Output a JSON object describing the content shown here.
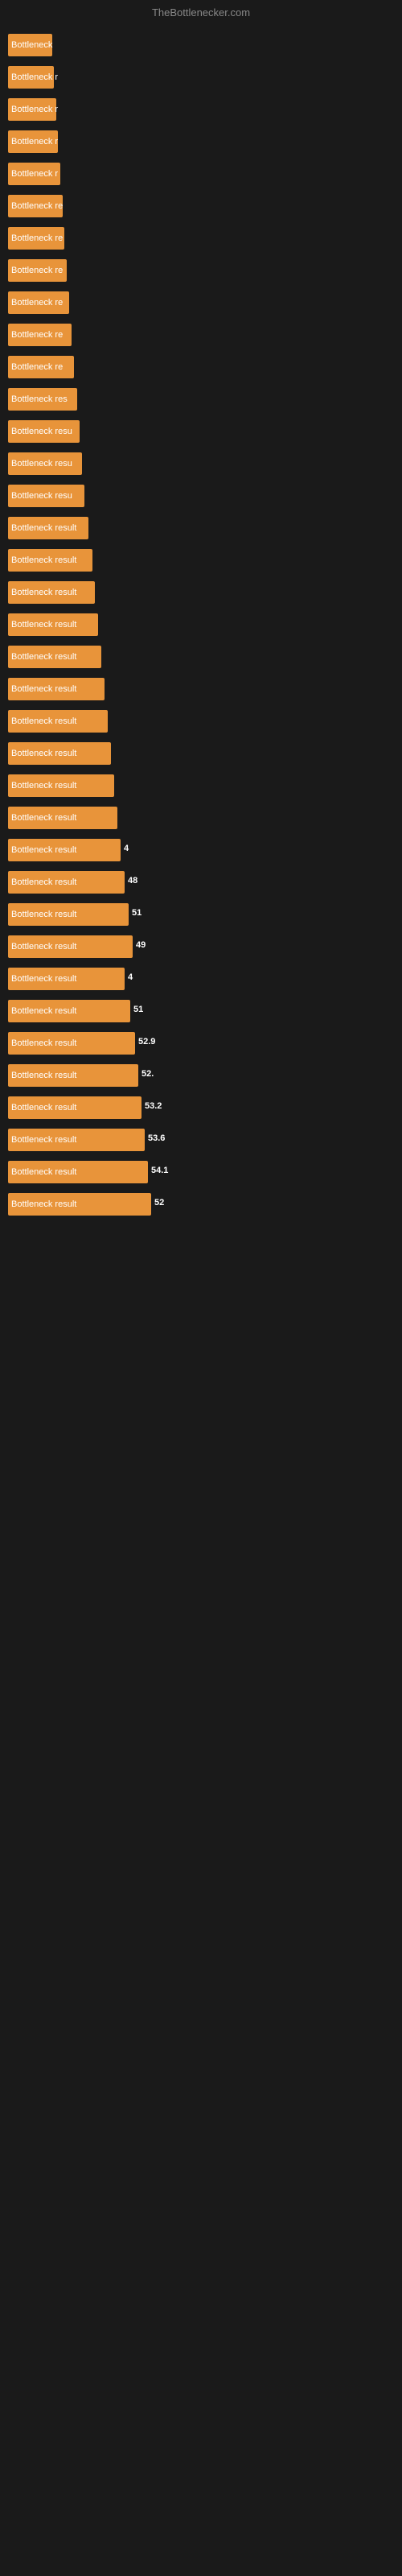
{
  "header": {
    "title": "TheBottlenecker.com"
  },
  "bars": [
    {
      "label": "Bottleneck",
      "width": 55,
      "value": "",
      "value_pos": "inside"
    },
    {
      "label": "Bottleneck r",
      "width": 57,
      "value": "",
      "value_pos": "inside"
    },
    {
      "label": "Bottleneck r",
      "width": 60,
      "value": "",
      "value_pos": "inside"
    },
    {
      "label": "Bottleneck r",
      "width": 62,
      "value": "",
      "value_pos": "inside"
    },
    {
      "label": "Bottleneck r",
      "width": 65,
      "value": "",
      "value_pos": "inside"
    },
    {
      "label": "Bottleneck re",
      "width": 68,
      "value": "",
      "value_pos": "inside"
    },
    {
      "label": "Bottleneck re",
      "width": 70,
      "value": "",
      "value_pos": "inside"
    },
    {
      "label": "Bottleneck re",
      "width": 73,
      "value": "",
      "value_pos": "inside"
    },
    {
      "label": "Bottleneck re",
      "width": 76,
      "value": "",
      "value_pos": "inside"
    },
    {
      "label": "Bottleneck re",
      "width": 79,
      "value": "",
      "value_pos": "inside"
    },
    {
      "label": "Bottleneck re",
      "width": 82,
      "value": "",
      "value_pos": "inside"
    },
    {
      "label": "Bottleneck res",
      "width": 86,
      "value": "",
      "value_pos": "inside"
    },
    {
      "label": "Bottleneck resu",
      "width": 89,
      "value": "",
      "value_pos": "inside"
    },
    {
      "label": "Bottleneck resu",
      "width": 92,
      "value": "",
      "value_pos": "inside"
    },
    {
      "label": "Bottleneck resu",
      "width": 95,
      "value": "",
      "value_pos": "inside"
    },
    {
      "label": "Bottleneck result",
      "width": 100,
      "value": "",
      "value_pos": "inside"
    },
    {
      "label": "Bottleneck result",
      "width": 105,
      "value": "",
      "value_pos": "inside"
    },
    {
      "label": "Bottleneck result",
      "width": 108,
      "value": "",
      "value_pos": "inside"
    },
    {
      "label": "Bottleneck result",
      "width": 112,
      "value": "",
      "value_pos": "inside"
    },
    {
      "label": "Bottleneck result",
      "width": 116,
      "value": "",
      "value_pos": "inside"
    },
    {
      "label": "Bottleneck result",
      "width": 120,
      "value": "",
      "value_pos": "inside"
    },
    {
      "label": "Bottleneck result",
      "width": 124,
      "value": "",
      "value_pos": "inside"
    },
    {
      "label": "Bottleneck result",
      "width": 128,
      "value": "",
      "value_pos": "inside"
    },
    {
      "label": "Bottleneck result",
      "width": 132,
      "value": "",
      "value_pos": "inside"
    },
    {
      "label": "Bottleneck result",
      "width": 136,
      "value": "",
      "value_pos": "inside"
    },
    {
      "label": "Bottleneck result",
      "width": 140,
      "value": "4",
      "value_pos": "outside"
    },
    {
      "label": "Bottleneck result",
      "width": 145,
      "value": "48",
      "value_pos": "outside"
    },
    {
      "label": "Bottleneck result",
      "width": 150,
      "value": "51",
      "value_pos": "outside"
    },
    {
      "label": "Bottleneck result",
      "width": 155,
      "value": "49",
      "value_pos": "outside"
    },
    {
      "label": "Bottleneck result",
      "width": 145,
      "value": "4",
      "value_pos": "outside"
    },
    {
      "label": "Bottleneck result",
      "width": 152,
      "value": "51",
      "value_pos": "outside"
    },
    {
      "label": "Bottleneck result",
      "width": 158,
      "value": "52.9",
      "value_pos": "outside"
    },
    {
      "label": "Bottleneck result",
      "width": 162,
      "value": "52.",
      "value_pos": "outside"
    },
    {
      "label": "Bottleneck result",
      "width": 166,
      "value": "53.2",
      "value_pos": "outside"
    },
    {
      "label": "Bottleneck result",
      "width": 170,
      "value": "53.6",
      "value_pos": "outside"
    },
    {
      "label": "Bottleneck result",
      "width": 174,
      "value": "54.1",
      "value_pos": "outside"
    },
    {
      "label": "Bottleneck result",
      "width": 178,
      "value": "52",
      "value_pos": "outside"
    }
  ]
}
